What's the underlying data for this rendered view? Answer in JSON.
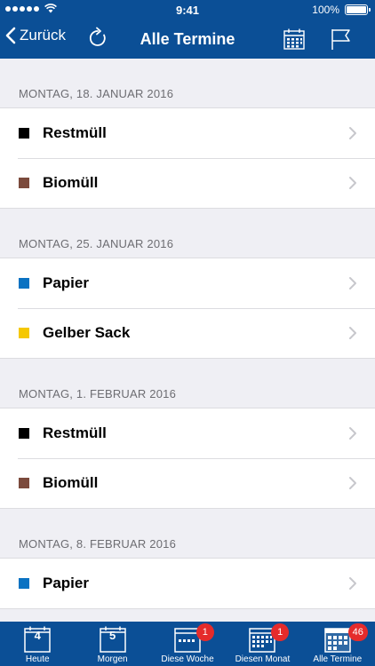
{
  "status": {
    "time": "9:41",
    "battery": "100%"
  },
  "nav": {
    "back_label": "Zurück",
    "title": "Alle Termine"
  },
  "sections": [
    {
      "date": "MONTAG, 18. JANUAR 2016",
      "items": [
        {
          "label": "Restmüll",
          "color": "#000000"
        },
        {
          "label": "Biomüll",
          "color": "#7b4a3c"
        }
      ]
    },
    {
      "date": "MONTAG, 25. JANUAR 2016",
      "items": [
        {
          "label": "Papier",
          "color": "#0a72c2"
        },
        {
          "label": "Gelber Sack",
          "color": "#f5c800"
        }
      ]
    },
    {
      "date": "MONTAG, 1. FEBRUAR 2016",
      "items": [
        {
          "label": "Restmüll",
          "color": "#000000"
        },
        {
          "label": "Biomüll",
          "color": "#7b4a3c"
        }
      ]
    },
    {
      "date": "MONTAG, 8. FEBRUAR 2016",
      "items": [
        {
          "label": "Papier",
          "color": "#0a72c2"
        }
      ]
    }
  ],
  "tabbar": {
    "tabs": [
      {
        "label": "Heute",
        "icon": "calendar-day-icon",
        "day": "4",
        "badge": ""
      },
      {
        "label": "Morgen",
        "icon": "calendar-day-icon",
        "day": "5",
        "badge": ""
      },
      {
        "label": "Diese Woche",
        "icon": "calendar-week-icon",
        "day": "",
        "badge": "1"
      },
      {
        "label": "Diesen Monat",
        "icon": "calendar-month-icon",
        "day": "",
        "badge": "1"
      },
      {
        "label": "Alle Termine",
        "icon": "calendar-all-icon",
        "day": "",
        "badge": "46"
      }
    ]
  },
  "colors": {
    "brand": "#0b4f96",
    "badge": "#e52b2b"
  }
}
